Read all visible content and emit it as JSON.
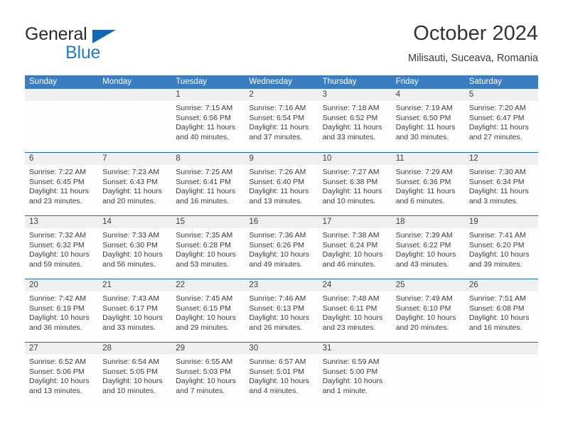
{
  "brand": {
    "name_part1": "General",
    "name_part2": "Blue",
    "triangle_color": "#1468b0",
    "blue_color": "#1f7dc4"
  },
  "header": {
    "title": "October 2024",
    "subtitle": "Milisauti, Suceava, Romania"
  },
  "theme": {
    "header_blue": "#3a7dc0",
    "row_divider_blue": "#1a6bb0",
    "daynum_strip": "#efefef",
    "cell_background": "#fdfdfd",
    "text": "#3a3a3a"
  },
  "weekdays": [
    "Sunday",
    "Monday",
    "Tuesday",
    "Wednesday",
    "Thursday",
    "Friday",
    "Saturday"
  ],
  "labels": {
    "sunrise_prefix": "Sunrise:",
    "sunset_prefix": "Sunset:",
    "daylight_prefix": "Daylight:"
  },
  "weeks": [
    [
      {
        "day": "",
        "empty": true
      },
      {
        "day": "",
        "empty": true
      },
      {
        "day": "1",
        "sunrise": "Sunrise: 7:15 AM",
        "sunset": "Sunset: 6:56 PM",
        "daylight_1": "Daylight: 11 hours",
        "daylight_2": "and 40 minutes."
      },
      {
        "day": "2",
        "sunrise": "Sunrise: 7:16 AM",
        "sunset": "Sunset: 6:54 PM",
        "daylight_1": "Daylight: 11 hours",
        "daylight_2": "and 37 minutes."
      },
      {
        "day": "3",
        "sunrise": "Sunrise: 7:18 AM",
        "sunset": "Sunset: 6:52 PM",
        "daylight_1": "Daylight: 11 hours",
        "daylight_2": "and 33 minutes."
      },
      {
        "day": "4",
        "sunrise": "Sunrise: 7:19 AM",
        "sunset": "Sunset: 6:50 PM",
        "daylight_1": "Daylight: 11 hours",
        "daylight_2": "and 30 minutes."
      },
      {
        "day": "5",
        "sunrise": "Sunrise: 7:20 AM",
        "sunset": "Sunset: 6:47 PM",
        "daylight_1": "Daylight: 11 hours",
        "daylight_2": "and 27 minutes."
      }
    ],
    [
      {
        "day": "6",
        "sunrise": "Sunrise: 7:22 AM",
        "sunset": "Sunset: 6:45 PM",
        "daylight_1": "Daylight: 11 hours",
        "daylight_2": "and 23 minutes."
      },
      {
        "day": "7",
        "sunrise": "Sunrise: 7:23 AM",
        "sunset": "Sunset: 6:43 PM",
        "daylight_1": "Daylight: 11 hours",
        "daylight_2": "and 20 minutes."
      },
      {
        "day": "8",
        "sunrise": "Sunrise: 7:25 AM",
        "sunset": "Sunset: 6:41 PM",
        "daylight_1": "Daylight: 11 hours",
        "daylight_2": "and 16 minutes."
      },
      {
        "day": "9",
        "sunrise": "Sunrise: 7:26 AM",
        "sunset": "Sunset: 6:40 PM",
        "daylight_1": "Daylight: 11 hours",
        "daylight_2": "and 13 minutes."
      },
      {
        "day": "10",
        "sunrise": "Sunrise: 7:27 AM",
        "sunset": "Sunset: 6:38 PM",
        "daylight_1": "Daylight: 11 hours",
        "daylight_2": "and 10 minutes."
      },
      {
        "day": "11",
        "sunrise": "Sunrise: 7:29 AM",
        "sunset": "Sunset: 6:36 PM",
        "daylight_1": "Daylight: 11 hours",
        "daylight_2": "and 6 minutes."
      },
      {
        "day": "12",
        "sunrise": "Sunrise: 7:30 AM",
        "sunset": "Sunset: 6:34 PM",
        "daylight_1": "Daylight: 11 hours",
        "daylight_2": "and 3 minutes."
      }
    ],
    [
      {
        "day": "13",
        "sunrise": "Sunrise: 7:32 AM",
        "sunset": "Sunset: 6:32 PM",
        "daylight_1": "Daylight: 10 hours",
        "daylight_2": "and 59 minutes."
      },
      {
        "day": "14",
        "sunrise": "Sunrise: 7:33 AM",
        "sunset": "Sunset: 6:30 PM",
        "daylight_1": "Daylight: 10 hours",
        "daylight_2": "and 56 minutes."
      },
      {
        "day": "15",
        "sunrise": "Sunrise: 7:35 AM",
        "sunset": "Sunset: 6:28 PM",
        "daylight_1": "Daylight: 10 hours",
        "daylight_2": "and 53 minutes."
      },
      {
        "day": "16",
        "sunrise": "Sunrise: 7:36 AM",
        "sunset": "Sunset: 6:26 PM",
        "daylight_1": "Daylight: 10 hours",
        "daylight_2": "and 49 minutes."
      },
      {
        "day": "17",
        "sunrise": "Sunrise: 7:38 AM",
        "sunset": "Sunset: 6:24 PM",
        "daylight_1": "Daylight: 10 hours",
        "daylight_2": "and 46 minutes."
      },
      {
        "day": "18",
        "sunrise": "Sunrise: 7:39 AM",
        "sunset": "Sunset: 6:22 PM",
        "daylight_1": "Daylight: 10 hours",
        "daylight_2": "and 43 minutes."
      },
      {
        "day": "19",
        "sunrise": "Sunrise: 7:41 AM",
        "sunset": "Sunset: 6:20 PM",
        "daylight_1": "Daylight: 10 hours",
        "daylight_2": "and 39 minutes."
      }
    ],
    [
      {
        "day": "20",
        "sunrise": "Sunrise: 7:42 AM",
        "sunset": "Sunset: 6:19 PM",
        "daylight_1": "Daylight: 10 hours",
        "daylight_2": "and 36 minutes."
      },
      {
        "day": "21",
        "sunrise": "Sunrise: 7:43 AM",
        "sunset": "Sunset: 6:17 PM",
        "daylight_1": "Daylight: 10 hours",
        "daylight_2": "and 33 minutes."
      },
      {
        "day": "22",
        "sunrise": "Sunrise: 7:45 AM",
        "sunset": "Sunset: 6:15 PM",
        "daylight_1": "Daylight: 10 hours",
        "daylight_2": "and 29 minutes."
      },
      {
        "day": "23",
        "sunrise": "Sunrise: 7:46 AM",
        "sunset": "Sunset: 6:13 PM",
        "daylight_1": "Daylight: 10 hours",
        "daylight_2": "and 26 minutes."
      },
      {
        "day": "24",
        "sunrise": "Sunrise: 7:48 AM",
        "sunset": "Sunset: 6:11 PM",
        "daylight_1": "Daylight: 10 hours",
        "daylight_2": "and 23 minutes."
      },
      {
        "day": "25",
        "sunrise": "Sunrise: 7:49 AM",
        "sunset": "Sunset: 6:10 PM",
        "daylight_1": "Daylight: 10 hours",
        "daylight_2": "and 20 minutes."
      },
      {
        "day": "26",
        "sunrise": "Sunrise: 7:51 AM",
        "sunset": "Sunset: 6:08 PM",
        "daylight_1": "Daylight: 10 hours",
        "daylight_2": "and 16 minutes."
      }
    ],
    [
      {
        "day": "27",
        "sunrise": "Sunrise: 6:52 AM",
        "sunset": "Sunset: 5:06 PM",
        "daylight_1": "Daylight: 10 hours",
        "daylight_2": "and 13 minutes."
      },
      {
        "day": "28",
        "sunrise": "Sunrise: 6:54 AM",
        "sunset": "Sunset: 5:05 PM",
        "daylight_1": "Daylight: 10 hours",
        "daylight_2": "and 10 minutes."
      },
      {
        "day": "29",
        "sunrise": "Sunrise: 6:55 AM",
        "sunset": "Sunset: 5:03 PM",
        "daylight_1": "Daylight: 10 hours",
        "daylight_2": "and 7 minutes."
      },
      {
        "day": "30",
        "sunrise": "Sunrise: 6:57 AM",
        "sunset": "Sunset: 5:01 PM",
        "daylight_1": "Daylight: 10 hours",
        "daylight_2": "and 4 minutes."
      },
      {
        "day": "31",
        "sunrise": "Sunrise: 6:59 AM",
        "sunset": "Sunset: 5:00 PM",
        "daylight_1": "Daylight: 10 hours",
        "daylight_2": "and 1 minute."
      },
      {
        "day": "",
        "empty": true
      },
      {
        "day": "",
        "empty": true
      }
    ]
  ]
}
